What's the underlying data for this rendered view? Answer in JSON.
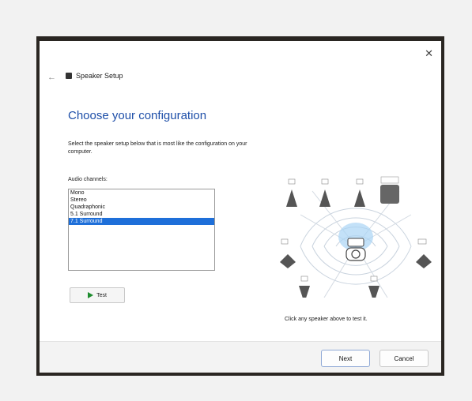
{
  "window": {
    "title": "Speaker Setup",
    "close_glyph": "✕",
    "back_glyph": "←"
  },
  "main": {
    "heading": "Choose your configuration",
    "description": "Select the speaker setup below that is most like the configuration on your computer.",
    "channels_label": "Audio channels:",
    "channels": [
      {
        "label": "Mono",
        "selected": false
      },
      {
        "label": "Stereo",
        "selected": false
      },
      {
        "label": "Quadraphonic",
        "selected": false
      },
      {
        "label": "5.1 Surround",
        "selected": false
      },
      {
        "label": "7.1 Surround",
        "selected": true
      }
    ],
    "test_label": "Test",
    "hint": "Click any speaker above to test it."
  },
  "footer": {
    "next_label": "Next",
    "cancel_label": "Cancel"
  },
  "colors": {
    "accent": "#1e6fd9",
    "heading": "#1d4ea8",
    "play": "#1e8c2e"
  },
  "icons": [
    "close-icon",
    "back-arrow-icon",
    "app-icon",
    "play-icon",
    "speaker-icon",
    "subwoofer-icon",
    "listener-icon"
  ]
}
